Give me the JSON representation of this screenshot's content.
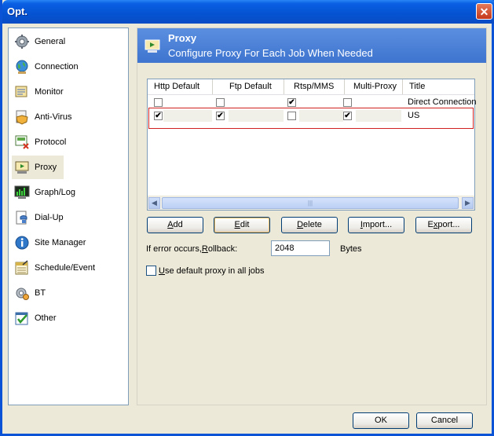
{
  "window": {
    "title": "Opt.",
    "close_symbol": "✕"
  },
  "sidebar": {
    "items": [
      {
        "label": "General",
        "icon": "gear-icon"
      },
      {
        "label": "Connection",
        "icon": "globe-icon"
      },
      {
        "label": "Monitor",
        "icon": "monitor-icon"
      },
      {
        "label": "Anti-Virus",
        "icon": "shield-icon"
      },
      {
        "label": "Protocol",
        "icon": "protocol-icon"
      },
      {
        "label": "Proxy",
        "icon": "proxy-icon"
      },
      {
        "label": "Graph/Log",
        "icon": "graph-icon"
      },
      {
        "label": "Dial-Up",
        "icon": "phone-icon"
      },
      {
        "label": "Site Manager",
        "icon": "info-icon"
      },
      {
        "label": "Schedule/Event",
        "icon": "calendar-icon"
      },
      {
        "label": "BT",
        "icon": "bt-icon"
      },
      {
        "label": "Other",
        "icon": "checklist-icon"
      }
    ],
    "selected": "Proxy"
  },
  "header": {
    "title": "Proxy",
    "subtitle": "Configure Proxy For Each Job When Needed"
  },
  "proxy_list": {
    "columns": [
      "Http Default",
      "Ftp Default",
      "Rtsp/MMS",
      "Multi-Proxy",
      "Title"
    ],
    "rows": [
      {
        "http": false,
        "ftp": false,
        "rtsp": true,
        "multi": false,
        "title": "Direct Connection"
      },
      {
        "http": true,
        "ftp": true,
        "rtsp": false,
        "multi": true,
        "title": "US"
      }
    ],
    "check_mark": "✔",
    "scroll_left": "◀",
    "scroll_right": "▶",
    "thumb_grip": "|||"
  },
  "buttons": {
    "add": {
      "u": "A",
      "rest": "dd"
    },
    "edit": {
      "u": "E",
      "rest": "dit"
    },
    "delete": {
      "u": "D",
      "rest": "elete"
    },
    "import": {
      "u": "I",
      "rest": "mport..."
    },
    "export": {
      "pre": "E",
      "u": "x",
      "rest": "port..."
    }
  },
  "rollback": {
    "label_pre": "If error occurs,",
    "label_u": "R",
    "label_post": "ollback:",
    "value": "2048",
    "unit": "Bytes"
  },
  "default_proxy": {
    "label_u": "U",
    "label_rest": "se default proxy in all jobs",
    "checked": false
  },
  "footer": {
    "ok": "OK",
    "cancel": "Cancel"
  }
}
